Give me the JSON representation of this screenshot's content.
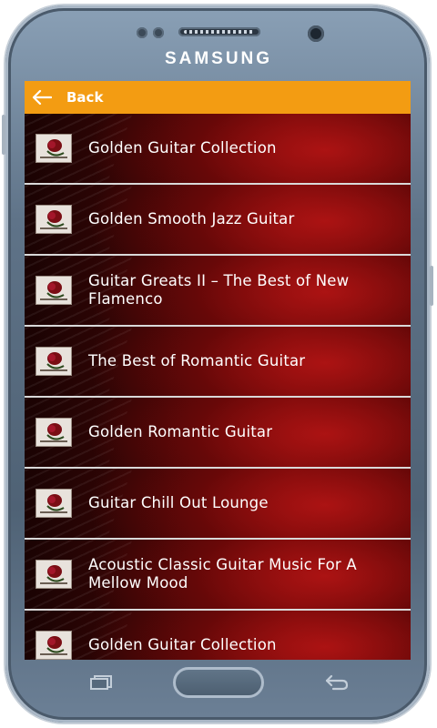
{
  "device": {
    "brand": "SAMSUNG"
  },
  "header": {
    "back_label": "Back",
    "color": "#f39c12"
  },
  "albums": [
    {
      "title": "Golden Guitar Collection"
    },
    {
      "title": "Golden Smooth Jazz Guitar"
    },
    {
      "title": "Guitar Greats II – The Best of New Flamenco"
    },
    {
      "title": "The Best of Romantic Guitar"
    },
    {
      "title": "Golden Romantic Guitar"
    },
    {
      "title": "Guitar Chill Out Lounge"
    },
    {
      "title": "Acoustic Classic Guitar Music For A Mellow Mood"
    },
    {
      "title": "Golden Guitar Collection"
    }
  ],
  "icons": {
    "back": "arrow-left-icon",
    "thumbnail": "rose-thumbnail-icon",
    "recents": "recents-icon",
    "home": "home-button",
    "nav_back": "nav-back-icon"
  }
}
